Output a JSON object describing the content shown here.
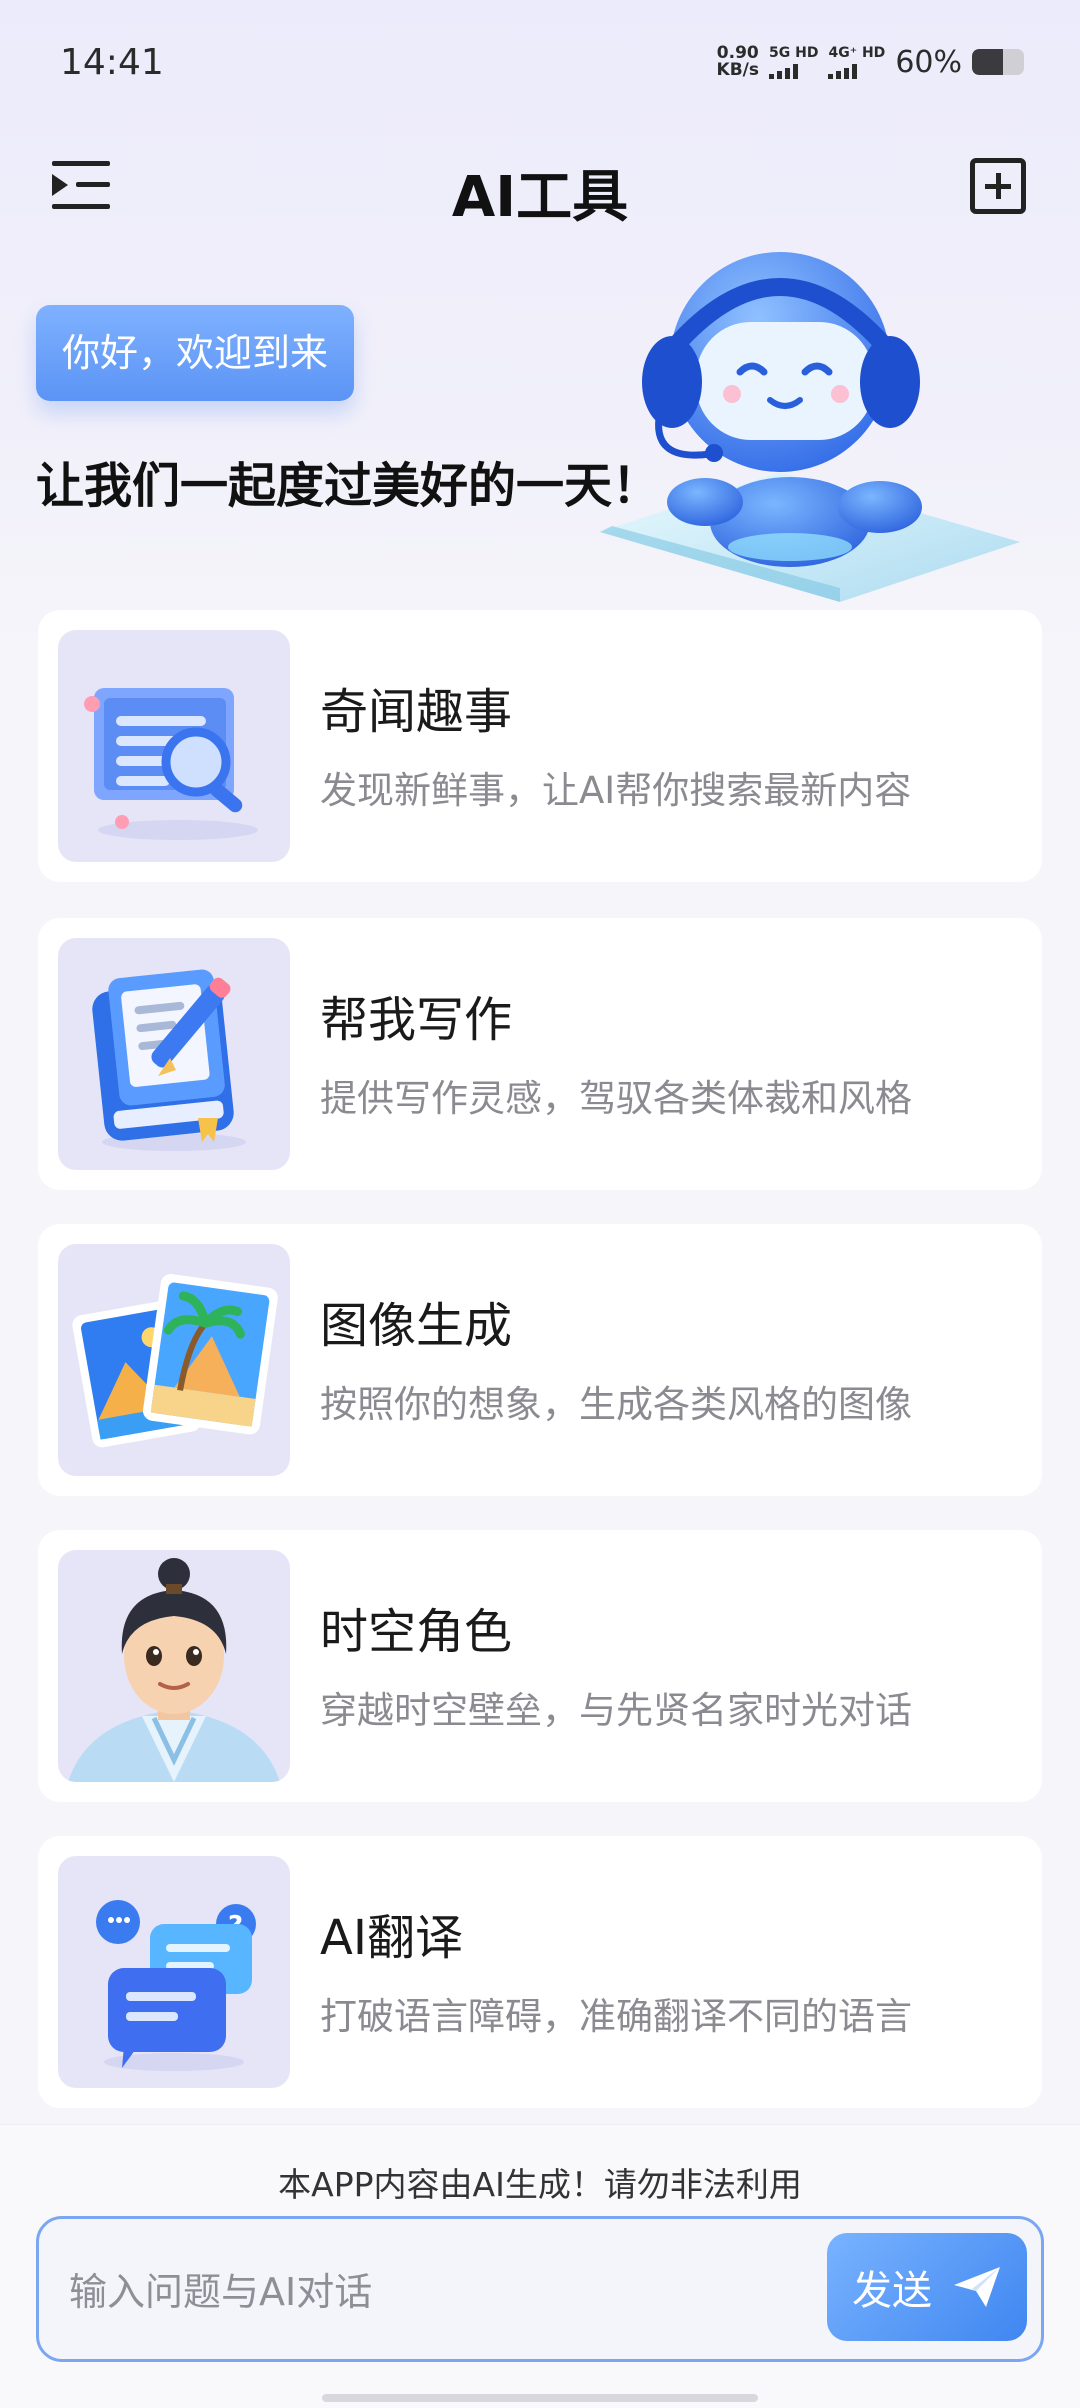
{
  "status_bar": {
    "time": "14:41",
    "net_speed_value": "0.90",
    "net_speed_unit": "KB/s",
    "sim1_label": "5G HD",
    "sim2_label": "4G⁺ HD",
    "battery_percent": "60%",
    "battery_level": 0.6
  },
  "header": {
    "title": "AI工具",
    "menu_icon": "menu-expand-icon",
    "add_icon": "add-square-icon"
  },
  "hero": {
    "greeting": "你好，欢迎到来",
    "subtitle": "让我们一起度过美好的一天！",
    "illustration": "robot-with-headset"
  },
  "tools": [
    {
      "title": "奇闻趣事",
      "desc": "发现新鲜事，让AI帮你搜索最新内容",
      "icon": "search-document-icon"
    },
    {
      "title": "帮我写作",
      "desc": "提供写作灵感，驾驭各类体裁和风格",
      "icon": "book-pencil-icon"
    },
    {
      "title": "图像生成",
      "desc": "按照你的想象，生成各类风格的图像",
      "icon": "photo-cards-icon"
    },
    {
      "title": "时空角色",
      "desc": "穿越时空壁垒，与先贤名家时光对话",
      "icon": "ancient-character-avatar"
    },
    {
      "title": "AI翻译",
      "desc": "打破语言障碍，准确翻译不同的语言",
      "icon": "chat-bubbles-icon"
    }
  ],
  "footer": {
    "disclaimer": "本APP内容由AI生成！请勿非法利用",
    "input_placeholder": "输入问题与AI对话",
    "send_label": "发送"
  },
  "colors": {
    "accent": "#4a8cf3",
    "card_thumb_bg": "#e6e5f7",
    "desc_text": "#8a8a90"
  }
}
